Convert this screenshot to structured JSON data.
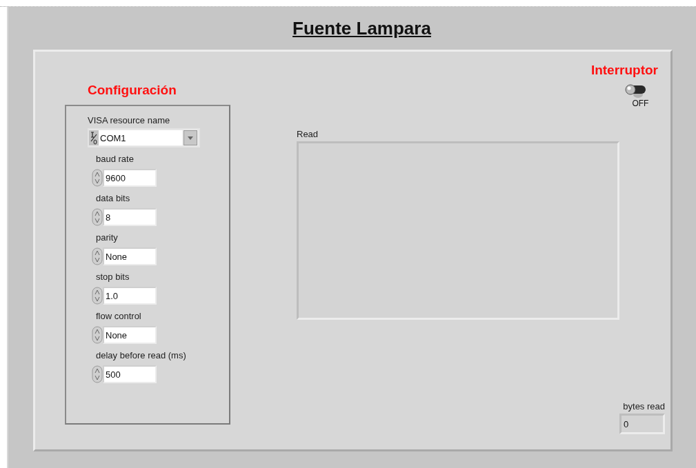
{
  "title": "Fuente Lampara",
  "configuration": {
    "label": "Configuración",
    "resource": {
      "label": "VISA resource name",
      "value": "COM1"
    },
    "parameters": [
      {
        "label": "baud rate",
        "value": "9600"
      },
      {
        "label": "data bits",
        "value": "8"
      },
      {
        "label": "parity",
        "value": "None"
      },
      {
        "label": "stop bits",
        "value": "1.0"
      },
      {
        "label": "flow control",
        "value": "None"
      },
      {
        "label": "delay before read (ms)",
        "value": "500"
      }
    ]
  },
  "switch": {
    "label": "Interruptor",
    "state_text": "OFF",
    "on": false
  },
  "read": {
    "label": "Read"
  },
  "bytes_read": {
    "label": "bytes read",
    "value": "0"
  }
}
